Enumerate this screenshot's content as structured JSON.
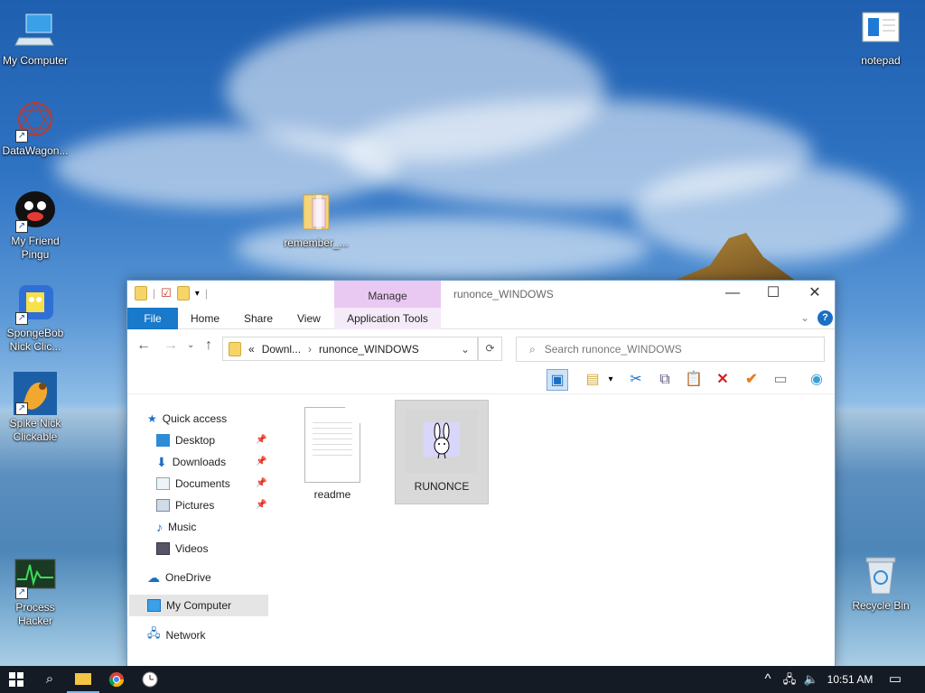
{
  "desktop": {
    "icons_left": [
      {
        "label": "My Computer",
        "icon": "computer-icon"
      },
      {
        "label": "DataWagon...",
        "icon": "datawagon-icon"
      },
      {
        "label": "My Friend Pingu",
        "icon": "pingu-icon"
      },
      {
        "label": "SpongeBob Nick Clic...",
        "icon": "spongebob-icon"
      },
      {
        "label": "Spike Nick Clickable",
        "icon": "spike-icon"
      },
      {
        "label": "Process Hacker",
        "icon": "process-hacker-icon"
      }
    ],
    "icon_middle": {
      "label": "remember_...",
      "icon": "folder-zip-icon"
    },
    "icons_right": [
      {
        "label": "notepad",
        "icon": "notepad-icon"
      },
      {
        "label": "Recycle Bin",
        "icon": "recycle-bin-icon"
      }
    ]
  },
  "explorer": {
    "title": "runonce_WINDOWS",
    "manage_tab": "Manage",
    "ribbon_tabs": [
      "File",
      "Home",
      "Share",
      "View",
      "Application Tools"
    ],
    "address": {
      "prefix": "«",
      "crumbs": [
        "Downl...",
        "runonce_WINDOWS"
      ]
    },
    "search_placeholder": "Search runonce_WINDOWS",
    "nav": {
      "quick_access": "Quick access",
      "pinned": [
        "Desktop",
        "Downloads",
        "Documents",
        "Pictures"
      ],
      "other": [
        "Music",
        "Videos"
      ],
      "onedrive": "OneDrive",
      "my_computer": "My Computer",
      "network": "Network"
    },
    "files": [
      {
        "name": "readme",
        "icon": "text-document-icon",
        "selected": false
      },
      {
        "name": "RUNONCE",
        "icon": "bunny-app-icon",
        "selected": true
      }
    ]
  },
  "taskbar": {
    "time": "10:51 AM"
  }
}
